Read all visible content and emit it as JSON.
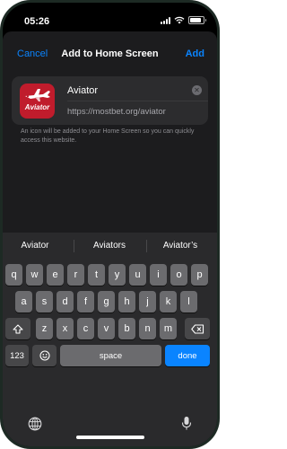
{
  "status_bar": {
    "time": "05:26"
  },
  "sheet": {
    "cancel_label": "Cancel",
    "title": "Add to Home Screen",
    "add_label": "Add",
    "accent_color": "#0a84ff"
  },
  "app": {
    "icon_brand": "Aviator",
    "icon_color": "#c01c2c",
    "name_value": "Aviator",
    "url": "https://mostbet.org/aviator"
  },
  "info": {
    "text": "An icon will be added to your Home Screen so you can quickly access this website."
  },
  "keyboard": {
    "suggestions": [
      "Aviator",
      "Aviators",
      "Aviator’s"
    ],
    "row1": [
      "q",
      "w",
      "e",
      "r",
      "t",
      "y",
      "u",
      "i",
      "o",
      "p"
    ],
    "row2": [
      "a",
      "s",
      "d",
      "f",
      "g",
      "h",
      "j",
      "k",
      "l"
    ],
    "row3": [
      "z",
      "x",
      "c",
      "v",
      "b",
      "n",
      "m"
    ],
    "numbers_label": "123",
    "space_label": "space",
    "done_label": "done",
    "shift_icon": "shift-icon",
    "delete_icon": "delete-icon",
    "emoji_icon": "emoji-icon",
    "globe_icon": "globe-icon",
    "mic_icon": "microphone-icon"
  }
}
